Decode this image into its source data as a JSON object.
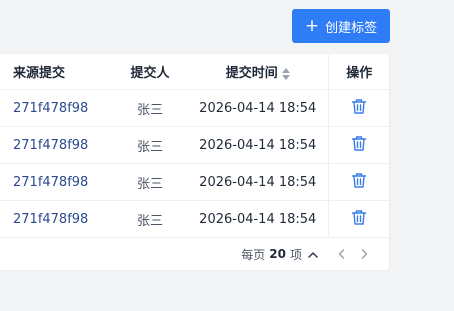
{
  "toolbar": {
    "create_label": "创建标签",
    "create_icon": "plus-icon"
  },
  "table": {
    "columns": {
      "source": "来源提交",
      "person": "提交人",
      "time": "提交时间",
      "op": "操作"
    },
    "rows": [
      {
        "source": "271f478f98",
        "person": "张三",
        "time": "2026-04-14 18:54"
      },
      {
        "source": "271f478f98",
        "person": "张三",
        "time": "2026-04-14 18:54"
      },
      {
        "source": "271f478f98",
        "person": "张三",
        "time": "2026-04-14 18:54"
      },
      {
        "source": "271f478f98",
        "person": "张三",
        "time": "2026-04-14 18:54"
      }
    ],
    "row_action_icon": "trash-icon"
  },
  "pagination": {
    "prefix": "每页",
    "size": "20",
    "suffix": "项"
  },
  "colors": {
    "accent": "#2f7df6",
    "link": "#2b4a8f",
    "action": "#3b7de8"
  }
}
